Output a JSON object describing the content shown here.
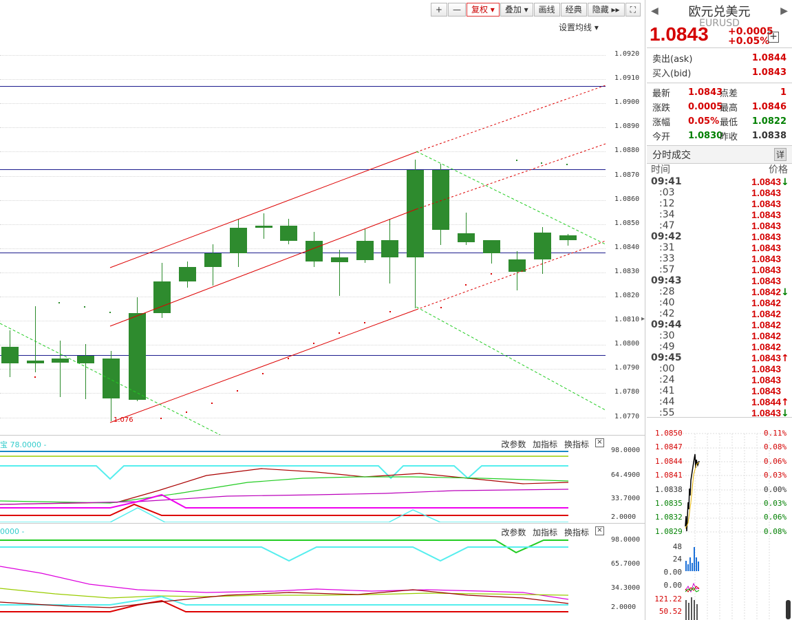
{
  "toolbar": {
    "plus": "+",
    "minus": "—",
    "fuquan": "复权",
    "diejia": "叠加",
    "huaxian": "画线",
    "jingdian": "经典",
    "yincang": "隐藏",
    "fullscreen": "⛶"
  },
  "set_ma": "设置均线",
  "price_axis": [
    "1.0920",
    "1.0910",
    "1.0900",
    "1.0890",
    "1.0880",
    "1.0870",
    "1.0860",
    "1.0850",
    "1.0840",
    "1.0830",
    "1.0820",
    "1.0810",
    "1.0800",
    "1.0790",
    "1.0780",
    "1.0770"
  ],
  "low_label": "1.076",
  "ind1": {
    "title": "宝 78.0000 -",
    "tools": "改参数 加指标 换指标",
    "close": "×",
    "axis": [
      "98.0000",
      "64.4900",
      "33.7000",
      "2.0000"
    ]
  },
  "ind2": {
    "title": "0000 -",
    "tools": "改参数 加指标 换指标",
    "close": "×",
    "axis": [
      "98.0000",
      "65.7000",
      "34.3000",
      "2.0000"
    ]
  },
  "panel": {
    "name": "欧元兑美元",
    "code": "EURUSD",
    "price": "1.0843",
    "chg": "+0.0005",
    "pct": "+0.05%",
    "ask_label": "卖出(ask)",
    "ask": "1.0844",
    "bid_label": "买入(bid)",
    "bid": "1.0843",
    "stats": [
      {
        "l1": "最新",
        "v1": "1.0843",
        "l2": "点差",
        "v2": "1"
      },
      {
        "l1": "涨跌",
        "v1": "0.0005",
        "l2": "最高",
        "v2": "1.0846"
      },
      {
        "l1": "涨幅",
        "v1": "0.05%",
        "l2": "最低",
        "v2": "1.0822"
      },
      {
        "l1": "今开",
        "v1": "1.0830",
        "l2": "昨收",
        "v2": "1.0838"
      }
    ],
    "ticks_title": "分时成交",
    "ticks_btn": "详",
    "col_time": "时间",
    "col_price": "价格",
    "ticks": [
      {
        "t": "09:41",
        "p": "1.0843",
        "a": "↓"
      },
      {
        "t": ":03",
        "p": "1.0843",
        "a": ""
      },
      {
        "t": ":12",
        "p": "1.0843",
        "a": ""
      },
      {
        "t": ":34",
        "p": "1.0843",
        "a": ""
      },
      {
        "t": ":47",
        "p": "1.0843",
        "a": ""
      },
      {
        "t": "09:42",
        "p": "1.0843",
        "a": ""
      },
      {
        "t": ":31",
        "p": "1.0843",
        "a": ""
      },
      {
        "t": ":33",
        "p": "1.0843",
        "a": ""
      },
      {
        "t": ":57",
        "p": "1.0843",
        "a": ""
      },
      {
        "t": "09:43",
        "p": "1.0843",
        "a": ""
      },
      {
        "t": ":28",
        "p": "1.0842",
        "a": "↓"
      },
      {
        "t": ":40",
        "p": "1.0842",
        "a": ""
      },
      {
        "t": ":42",
        "p": "1.0842",
        "a": ""
      },
      {
        "t": "09:44",
        "p": "1.0842",
        "a": ""
      },
      {
        "t": ":30",
        "p": "1.0842",
        "a": ""
      },
      {
        "t": ":49",
        "p": "1.0842",
        "a": ""
      },
      {
        "t": "09:45",
        "p": "1.0843",
        "a": "↑"
      },
      {
        "t": ":00",
        "p": "1.0843",
        "a": ""
      },
      {
        "t": ":24",
        "p": "1.0843",
        "a": ""
      },
      {
        "t": ":41",
        "p": "1.0843",
        "a": ""
      },
      {
        "t": ":44",
        "p": "1.0844",
        "a": "↑"
      },
      {
        "t": ":55",
        "p": "1.0843",
        "a": "↓"
      }
    ],
    "mini_left": [
      "1.0850",
      "1.0847",
      "1.0844",
      "1.0841",
      "1.0838",
      "1.0835",
      "1.0832",
      "1.0829"
    ],
    "mini_right": [
      "0.11%",
      "0.08%",
      "0.06%",
      "0.03%",
      "0.00%",
      "0.03%",
      "0.06%",
      "0.08%"
    ],
    "mini_sub": [
      "48",
      "24",
      "0.00",
      "0.00",
      "121.22",
      "50.52"
    ]
  }
}
